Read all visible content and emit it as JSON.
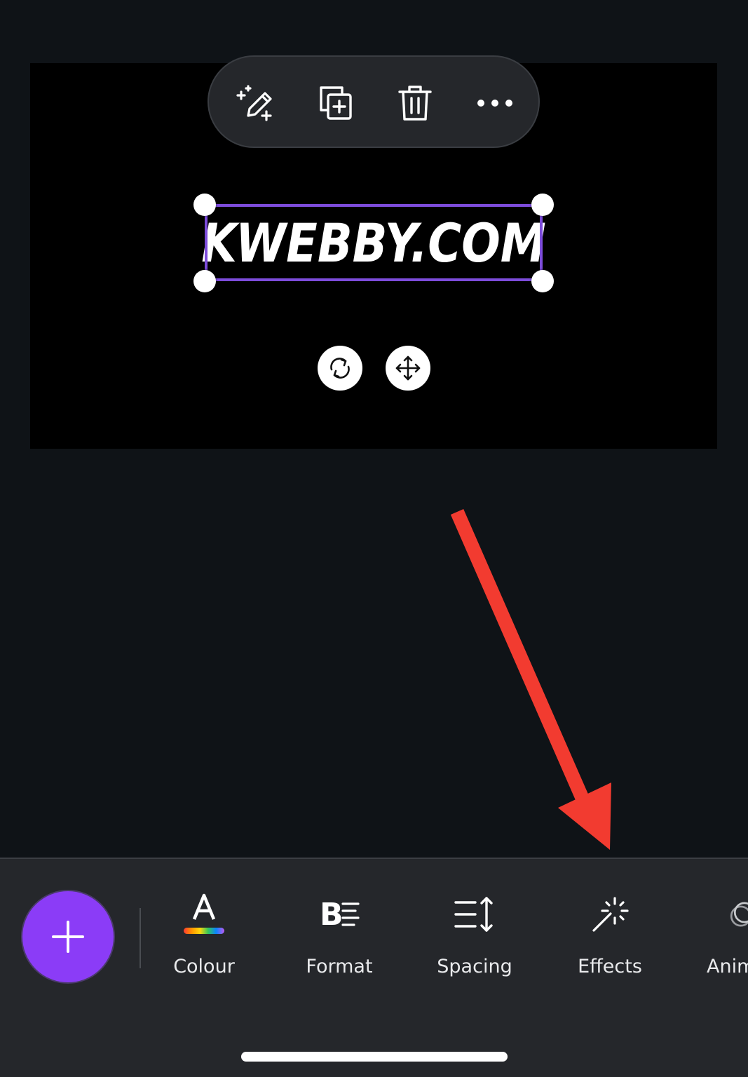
{
  "canvas": {
    "text": "KWEBBY.COM"
  },
  "floating_toolbar": {
    "icons": [
      "magic-edit-icon",
      "duplicate-icon",
      "trash-icon",
      "more-icon"
    ]
  },
  "transform_controls": {
    "icons": [
      "rotate-icon",
      "move-icon"
    ]
  },
  "bottom_toolbar": {
    "add_icon": "plus-icon",
    "tools": [
      {
        "label": "Colour",
        "icon": "text-colour-icon"
      },
      {
        "label": "Format",
        "icon": "format-icon"
      },
      {
        "label": "Spacing",
        "icon": "spacing-icon"
      },
      {
        "label": "Effects",
        "icon": "effects-wand-icon"
      },
      {
        "label": "Anim",
        "icon": "animate-icon"
      }
    ]
  },
  "annotation": {
    "arrow_color": "#f23b30"
  },
  "colors": {
    "accent": "#8b3cf7",
    "selection": "#7d4cdb",
    "background": "#0f1317",
    "toolbar": "#25272b"
  }
}
